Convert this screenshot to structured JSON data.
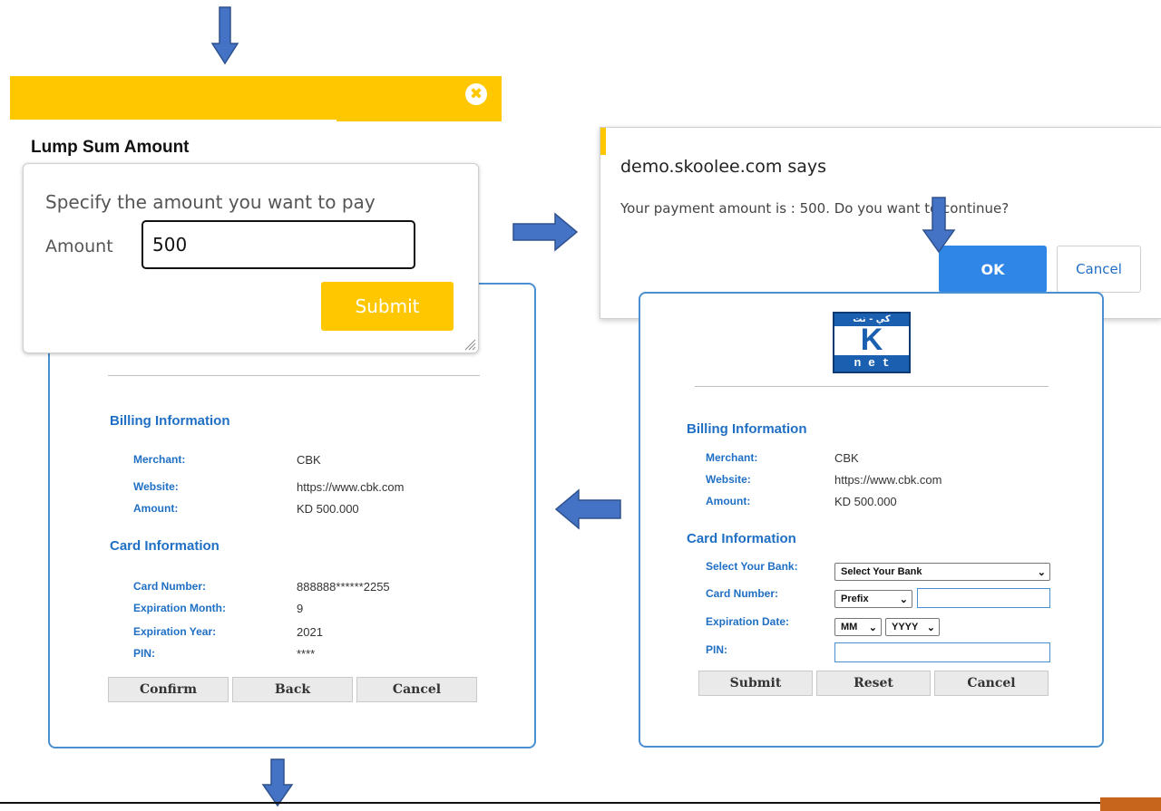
{
  "lump_sum": {
    "title": "Lump Sum Amount",
    "close_glyph": "✖",
    "instruction": "Specify the amount you want to pay",
    "amount_label": "Amount",
    "amount_value": "500",
    "submit_label": "Submit"
  },
  "confirm_dialog": {
    "title": "demo.skoolee.com says",
    "message": "Your payment amount is : 500. Do you want to continue?",
    "ok_label": "OK",
    "cancel_label": "Cancel"
  },
  "knet_entry": {
    "logo_top": "كي - نت",
    "logo_letter": "K",
    "logo_bottom": "n e t",
    "billing_title": "Billing Information",
    "merchant_label": "Merchant:",
    "merchant_value": "CBK",
    "website_label": "Website:",
    "website_value": "https://www.cbk.com",
    "amount_label": "Amount:",
    "amount_value": "KD 500.000",
    "card_title": "Card Information",
    "bank_label": "Select Your Bank:",
    "bank_value": "Select Your Bank",
    "card_number_label": "Card Number:",
    "prefix_value": "Prefix",
    "expiration_label": "Expiration Date:",
    "month_value": "MM",
    "year_value": "YYYY",
    "pin_label": "PIN:",
    "submit_label": "Submit",
    "reset_label": "Reset",
    "cancel_label": "Cancel"
  },
  "knet_confirm": {
    "billing_title": "Billing Information",
    "merchant_label": "Merchant:",
    "merchant_value": "CBK",
    "website_label": "Website:",
    "website_value": "https://www.cbk.com",
    "amount_label": "Amount:",
    "amount_value": "KD 500.000",
    "card_title": "Card Information",
    "card_number_label": "Card Number:",
    "card_number_value": "888888******2255",
    "exp_month_label": "Expiration Month:",
    "exp_month_value": "9",
    "exp_year_label": "Expiration Year:",
    "exp_year_value": "2021",
    "pin_label": "PIN:",
    "pin_value": "****",
    "confirm_label": "Confirm",
    "back_label": "Back",
    "cancel_label": "Cancel"
  },
  "colors": {
    "arrow": "#4472c4",
    "yellow": "#ffc700",
    "knet_blue": "#1f6fc4",
    "ok_blue": "#2f86e6"
  }
}
